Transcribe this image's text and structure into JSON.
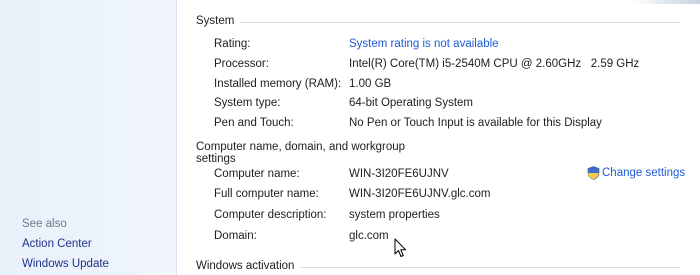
{
  "sidebar": {
    "see_also": "See also",
    "links": [
      "Action Center",
      "Windows Update"
    ]
  },
  "system": {
    "heading": "System",
    "rows": [
      {
        "label": "Rating:",
        "value": "System rating is not available",
        "is_link": true
      },
      {
        "label": "Processor:",
        "value": "Intel(R) Core(TM) i5-2540M CPU @ 2.60GHz   2.59 GHz"
      },
      {
        "label": "Installed memory (RAM):",
        "value": "1.00 GB"
      },
      {
        "label": "System type:",
        "value": "64-bit Operating System"
      },
      {
        "label": "Pen and Touch:",
        "value": "No Pen or Touch Input is available for this Display"
      }
    ]
  },
  "computer": {
    "heading": "Computer name, domain, and workgroup settings",
    "change_settings": "Change settings",
    "rows": [
      {
        "label": "Computer name:",
        "value": "WIN-3I20FE6UJNV"
      },
      {
        "label": "Full computer name:",
        "value": "WIN-3I20FE6UJNV.glc.com"
      },
      {
        "label": "Computer description:",
        "value": "system properties"
      },
      {
        "label": "Domain:",
        "value": "glc.com"
      }
    ]
  },
  "activation": {
    "heading": "Windows activation"
  },
  "colors": {
    "link": "#1e5bd6",
    "sidebar_link": "#1e3287",
    "section_line": "#d7dde5",
    "sidebar_bg": "#e9f0fa"
  },
  "icons": [
    "uac-shield-icon",
    "mouse-cursor-icon"
  ]
}
